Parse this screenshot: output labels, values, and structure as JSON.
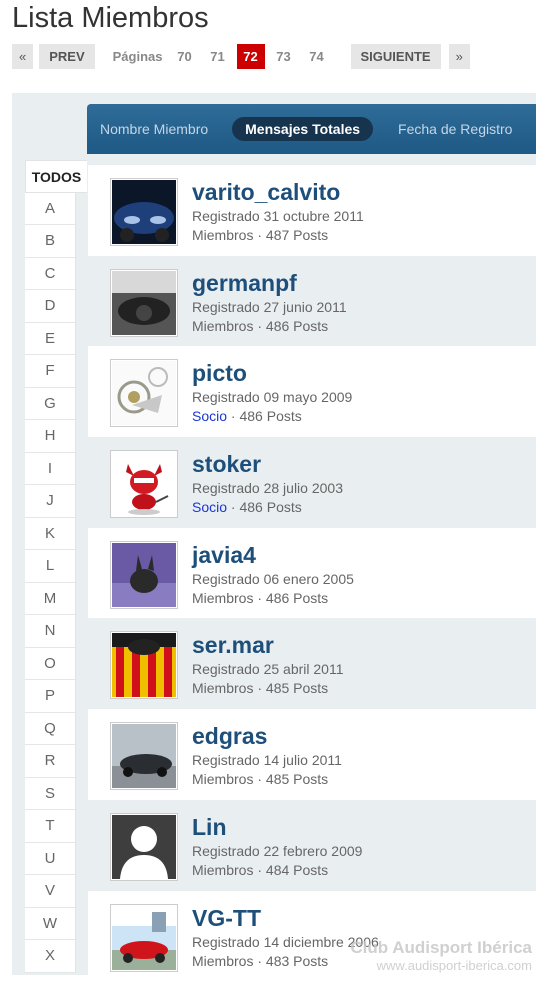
{
  "page": {
    "title": "Lista Miembros"
  },
  "pager": {
    "first": "«",
    "prev": "PREV",
    "pages_label": "Páginas",
    "pages": [
      "70",
      "71",
      "72",
      "73",
      "74"
    ],
    "current": "72",
    "next": "SIGUIENTE",
    "last": "»"
  },
  "sort": {
    "name": "Nombre Miembro",
    "posts": "Mensajes Totales",
    "date": "Fecha de Registro"
  },
  "letters": [
    "TODOS",
    "A",
    "B",
    "C",
    "D",
    "E",
    "F",
    "G",
    "H",
    "I",
    "J",
    "K",
    "L",
    "M",
    "N",
    "O",
    "P",
    "Q",
    "R",
    "S",
    "T",
    "U",
    "V",
    "W",
    "X"
  ],
  "members": [
    {
      "name": "varito_calvito",
      "registered": "Registrado 31 octubre 2011",
      "group": "Miembros",
      "posts": "487 Posts"
    },
    {
      "name": "germanpf",
      "registered": "Registrado 27 junio 2011",
      "group": "Miembros",
      "posts": "486 Posts"
    },
    {
      "name": "picto",
      "registered": "Registrado 09 mayo 2009",
      "group": "Socio",
      "posts": "486 Posts"
    },
    {
      "name": "stoker",
      "registered": "Registrado 28 julio 2003",
      "group": "Socio",
      "posts": "486 Posts"
    },
    {
      "name": "javia4",
      "registered": "Registrado 06 enero 2005",
      "group": "Miembros",
      "posts": "486 Posts"
    },
    {
      "name": "ser.mar",
      "registered": "Registrado 25 abril 2011",
      "group": "Miembros",
      "posts": "485 Posts"
    },
    {
      "name": "edgras",
      "registered": "Registrado 14 julio 2011",
      "group": "Miembros",
      "posts": "485 Posts"
    },
    {
      "name": "Lin",
      "registered": "Registrado 22 febrero 2009",
      "group": "Miembros",
      "posts": "484 Posts"
    },
    {
      "name": "VG-TT",
      "registered": "Registrado 14 diciembre 2006",
      "group": "Miembros",
      "posts": "483 Posts"
    }
  ],
  "separator": " · ",
  "watermark": {
    "brand": "Club Audisport Ibérica",
    "url": "www.audisport-iberica.com"
  }
}
